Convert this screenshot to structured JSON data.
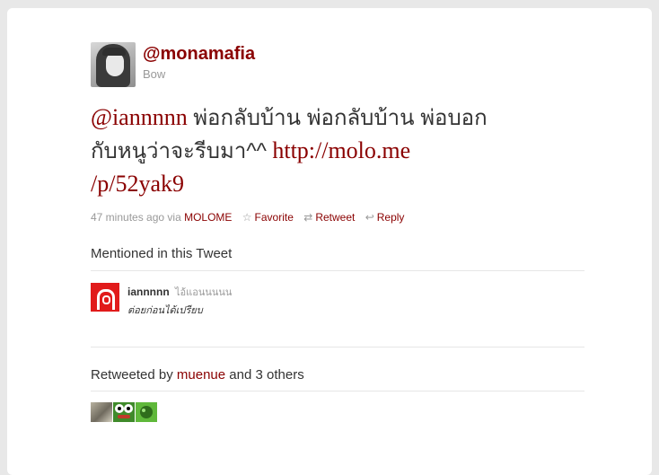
{
  "user": {
    "screen_name": "@monamafia",
    "full_name": "Bow"
  },
  "tweet": {
    "mention": "@iannnnn",
    "text_line1": "พ่อกลับบ้าน พ่อกลับบ้าน พ่อบอก",
    "text_line2": "กับหนูว่าจะรีบมา^^",
    "link_part1": "http://molo.me",
    "link_part2": "/p/52yak9"
  },
  "meta": {
    "time": "47 minutes ago",
    "via_label": "via",
    "via_source": "MOLOME",
    "favorite_label": "Favorite",
    "retweet_label": "Retweet",
    "reply_label": "Reply"
  },
  "mentioned": {
    "title": "Mentioned in this Tweet",
    "user": {
      "screen_name": "iannnnn",
      "full_name": "ไอ้แอนนนนน",
      "bio": "ต่อยก่อนได้เปรียบ"
    }
  },
  "retweets": {
    "prefix": "Retweeted by",
    "user": "muenue",
    "suffix": "and 3 others"
  },
  "colors": {
    "link": "#8a0000",
    "muted": "#999999",
    "text": "#333333"
  }
}
